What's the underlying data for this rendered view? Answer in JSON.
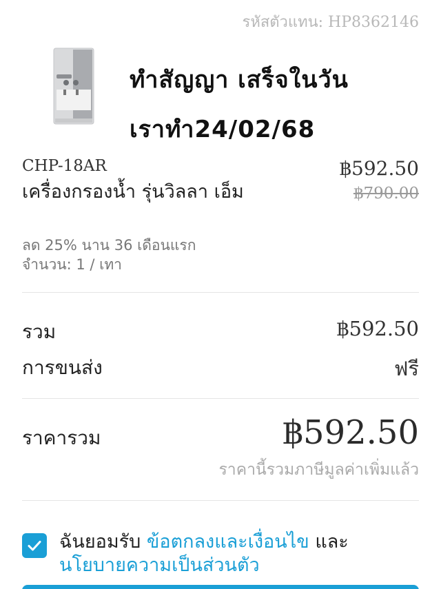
{
  "header": {
    "rep_code": "รหัสตัวแทน: HP8362146"
  },
  "handwriting": {
    "line1": "ทำสัญญา เสร็จในวัน",
    "line2": "เราทำ24/02/68"
  },
  "product": {
    "sku": "CHP-18AR",
    "name": "เครื่องกรองน้ำ รุ่นวิลลา เอ็ม",
    "discount_note": "ลด 25% นาน 36 เดือนแรก",
    "quantity": "จำนวน: 1 / เทา",
    "price": "฿592.50",
    "original_price": "฿790.00",
    "image_icon": "water-purifier-image"
  },
  "summary": {
    "subtotal_label": "รวม",
    "subtotal_value": "฿592.50",
    "shipping_label": "การขนส่ง",
    "shipping_value": "ฟรี",
    "total_label": "ราคารวม",
    "total_value": "฿592.50",
    "vat_note": "ราคานี้รวมภาษีมูลค่าเพิ่มแล้ว"
  },
  "consent": {
    "prefix": "ฉันยอมรับ ",
    "terms_link": "ข้อตกลงและเงื่อนไข",
    "and": " และ ",
    "privacy_link": "นโยบายความเป็นส่วนตัว",
    "checked": true
  },
  "colors": {
    "accent": "#1a9fd6"
  }
}
